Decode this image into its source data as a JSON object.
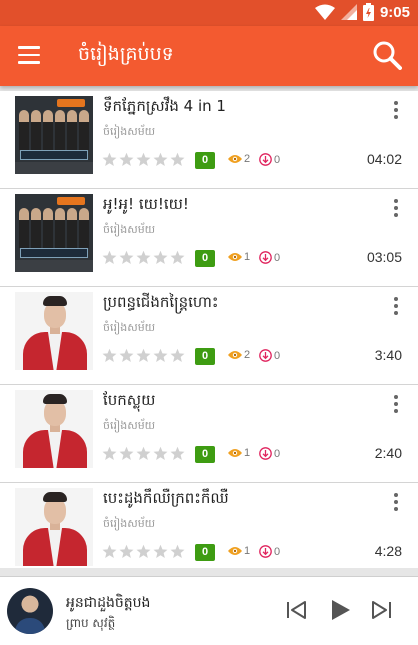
{
  "status_bar": {
    "time": "9:05"
  },
  "toolbar": {
    "title": "ចំរៀងគ្រប់បទ"
  },
  "songs": [
    {
      "title": "ទឹកភ្នែកស្រវឹង 4 in 1",
      "subtitle": "ចំរៀងសម័យ",
      "rating": "0",
      "views": "2",
      "downloads": "0",
      "duration": "04:02",
      "thumb": "album-cover"
    },
    {
      "title": "អូ!អូ! យេ!យេ!",
      "subtitle": "ចំរៀងសម័យ",
      "rating": "0",
      "views": "1",
      "downloads": "0",
      "duration": "03:05",
      "thumb": "album-cover"
    },
    {
      "title": "ប្រពន្ធជើងកន្ត្រៃហោះ",
      "subtitle": "ចំរៀងសម័យ",
      "rating": "0",
      "views": "2",
      "downloads": "0",
      "duration": "3:40",
      "thumb": "singer-photo"
    },
    {
      "title": "បែកស្លុយ",
      "subtitle": "ចំរៀងសម័យ",
      "rating": "0",
      "views": "1",
      "downloads": "0",
      "duration": "2:40",
      "thumb": "singer-photo"
    },
    {
      "title": "បេះដូងកឹឈឺក្រពះកឹឈឺ",
      "subtitle": "ចំរៀងសម័យ",
      "rating": "0",
      "views": "1",
      "downloads": "0",
      "duration": "4:28",
      "thumb": "singer-photo"
    }
  ],
  "player": {
    "title": "អូនជាដួងចិត្តបង",
    "artist": "ព្រាប សុវត្ថិ"
  },
  "colors": {
    "status_bar": "#e2502b",
    "toolbar": "#f35a30",
    "rating_badge": "#3e9c12",
    "views_icon": "#f0a020",
    "download_icon": "#e0245e",
    "star": "#d0d0d0"
  },
  "icons": {
    "menu": "hamburger-icon",
    "search": "search-icon",
    "more": "more-vertical-icon",
    "views": "eye-icon",
    "downloads": "download-circle-icon",
    "prev": "skip-previous-icon",
    "play": "play-icon",
    "next": "skip-next-icon"
  }
}
